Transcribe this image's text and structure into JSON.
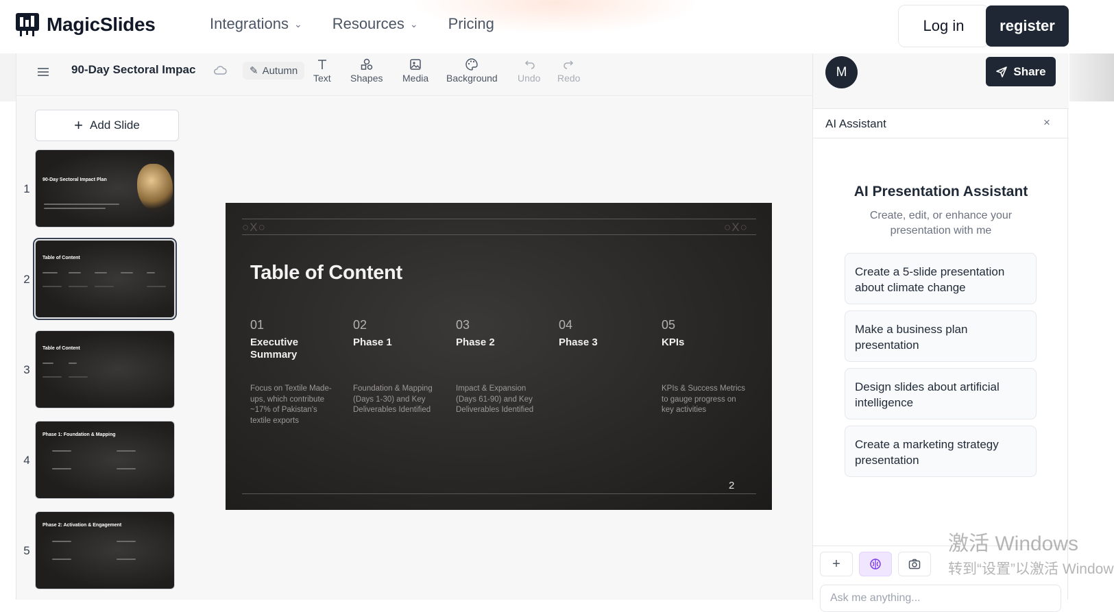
{
  "nav": {
    "brand": "MagicSlides",
    "links": [
      {
        "label": "Integrations",
        "dropdown": true
      },
      {
        "label": "Resources",
        "dropdown": true
      },
      {
        "label": "Pricing",
        "dropdown": false
      }
    ],
    "login": "Log in",
    "register": "register"
  },
  "toolbar": {
    "doc_title": "90-Day Sectoral Impac",
    "theme": "Autumn",
    "tools": [
      "Text",
      "Shapes",
      "Media",
      "Background",
      "Undo",
      "Redo"
    ]
  },
  "sidebar": {
    "add_slide": "Add Slide",
    "slides": [
      {
        "num": "1",
        "title": "90-Day Sectoral Impact Plan",
        "selected": false
      },
      {
        "num": "2",
        "title": "Table of Content",
        "selected": true
      },
      {
        "num": "3",
        "title": "Table of Content",
        "selected": false
      },
      {
        "num": "4",
        "title": "Phase 1: Foundation & Mapping",
        "selected": false
      },
      {
        "num": "5",
        "title": "Phase 2: Activation & Engagement",
        "selected": false
      }
    ]
  },
  "slide": {
    "title": "Table of Content",
    "mark": "○X○",
    "page": "2",
    "columns": [
      {
        "num": "01",
        "head": "Executive Summary",
        "desc": "Focus on Textile Made-ups, which contribute ~17% of Pakistan's textile exports"
      },
      {
        "num": "02",
        "head": "Phase 1",
        "desc": "Foundation & Mapping (Days 1-30) and Key Deliverables Identified"
      },
      {
        "num": "03",
        "head": "Phase 2",
        "desc": "Impact & Expansion (Days 61-90) and Key Deliverables Identified"
      },
      {
        "num": "04",
        "head": "Phase 3",
        "desc": ""
      },
      {
        "num": "05",
        "head": "KPIs",
        "desc": "KPIs & Success Metrics to gauge progress on key activities"
      }
    ]
  },
  "assistant": {
    "avatar": "M",
    "share": "Share",
    "header": "AI Assistant",
    "close": "×",
    "title": "AI Presentation Assistant",
    "subtitle": "Create, edit, or enhance your presentation with me",
    "suggestions": [
      "Create a 5-slide presentation about climate change",
      "Make a business plan presentation",
      "Design slides about artificial intelligence",
      "Create a marketing strategy presentation"
    ],
    "input_placeholder": "Ask me anything..."
  },
  "watermark": {
    "line1": "激活 Windows",
    "line2": "转到“设置”以激活 Windows。"
  }
}
